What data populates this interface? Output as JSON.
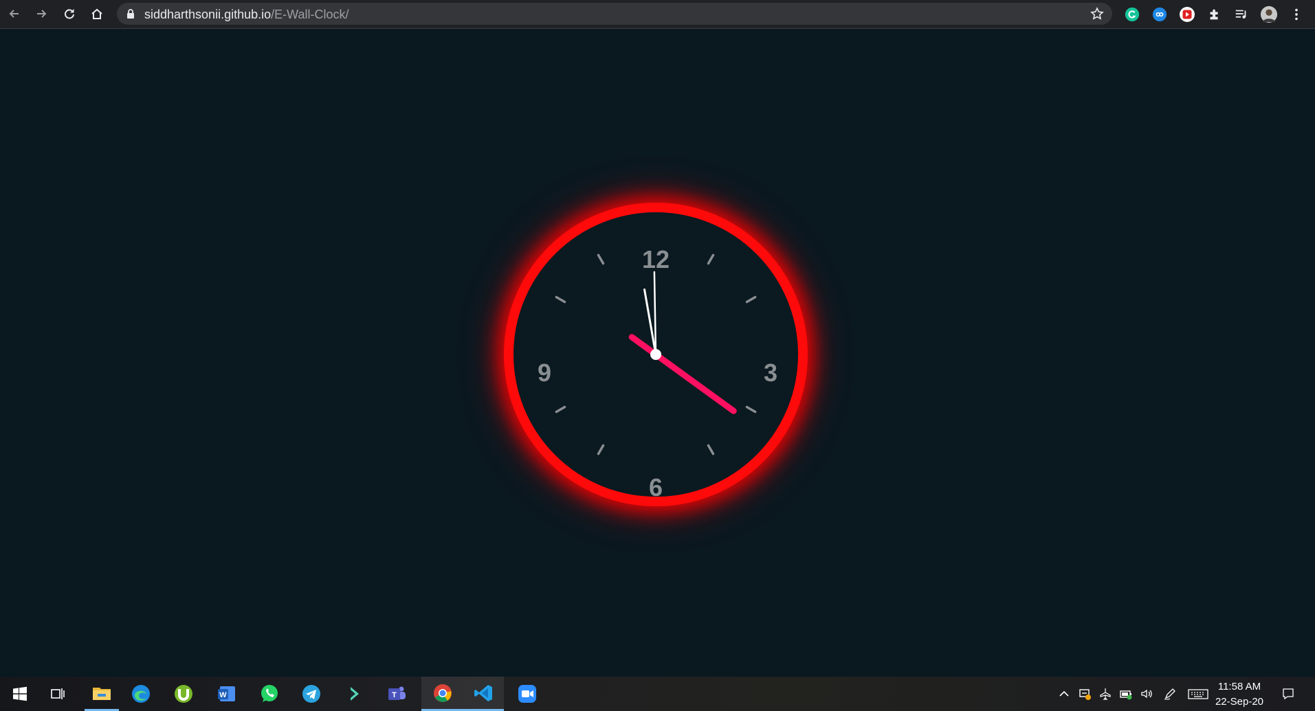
{
  "browser": {
    "url_host": "siddharthsonii.github.io",
    "url_path": "/E-Wall-Clock/"
  },
  "clock": {
    "numerals": {
      "twelve": "12",
      "three": "3",
      "six": "6",
      "nine": "9"
    },
    "time": {
      "hours": 11,
      "minutes": 58,
      "seconds": 21
    },
    "colors": {
      "ring": "#ff0a0a",
      "second_hand": "#ff1060",
      "hands": "#ffffff",
      "numerals": "#8a8f93",
      "ticks": "#8a8f93",
      "face": "#0b1920",
      "background": "#0a1820"
    }
  },
  "taskbar": {
    "apps": [
      "start-icon",
      "task-view-icon",
      "file-explorer-icon",
      "edge-icon",
      "utorrent-icon",
      "word-icon",
      "whatsapp-icon",
      "telegram-icon",
      "filmora-icon",
      "teams-icon",
      "chrome-icon",
      "vscode-icon",
      "zoom-icon"
    ],
    "time": "11:58 AM",
    "date": "22-Sep-20"
  }
}
